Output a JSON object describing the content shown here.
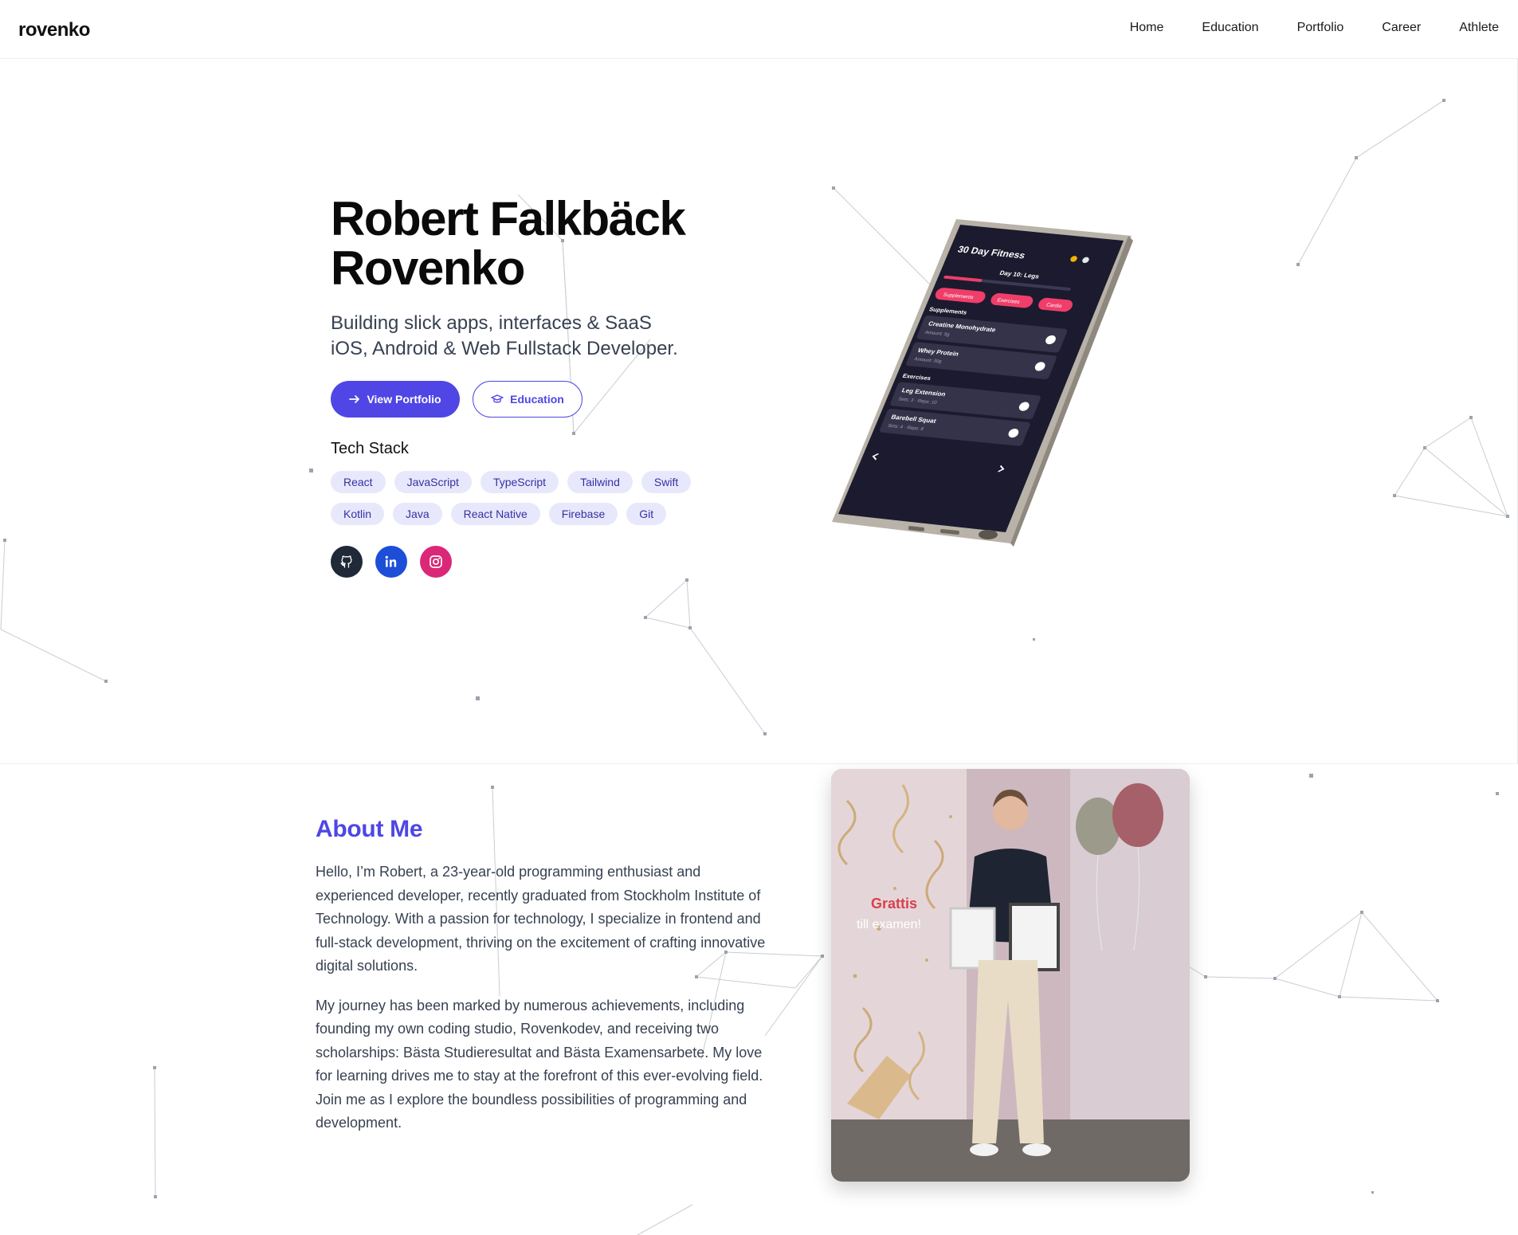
{
  "header": {
    "logo": "rovenko",
    "nav": [
      "Home",
      "Education",
      "Portfolio",
      "Career",
      "Athlete"
    ]
  },
  "hero": {
    "name_line1": "Robert Falkbäck",
    "name_line2": "Rovenko",
    "tagline_line1": "Building slick apps, interfaces & SaaS",
    "tagline_line2": "iOS, Android & Web Fullstack Developer.",
    "primary_button": "View Portfolio",
    "secondary_button": "Education",
    "stack_title": "Tech Stack",
    "stack": [
      "React",
      "JavaScript",
      "TypeScript",
      "Tailwind",
      "Swift",
      "Kotlin",
      "Java",
      "React Native",
      "Firebase",
      "Git"
    ],
    "socials": [
      "github-icon",
      "linkedin-icon",
      "instagram-icon"
    ]
  },
  "phone": {
    "app_title": "30 Day Fitness",
    "day": "Day 10: Legs",
    "tabs": [
      "Supplements",
      "Exercises",
      "Cardio"
    ],
    "section1": "Supplements",
    "items1": [
      {
        "name": "Creatine Monohydrate",
        "sub": "Amount: 5g"
      },
      {
        "name": "Whey Protein",
        "sub": "Amount: 30g"
      }
    ],
    "section2": "Exercises",
    "items2": [
      {
        "name": "Leg Extension",
        "sub": "Sets: 3 · Reps: 10"
      },
      {
        "name": "Barebell Squat",
        "sub": "Sets: 4 · Reps: 8"
      }
    ]
  },
  "about": {
    "title": "About Me",
    "p1": "Hello, I’m Robert, a 23-year-old programming enthusiast and experienced developer, recently graduated from Stockholm Institute of Technology. With a passion for technology, I specialize in frontend and full-stack development, thriving on the excitement of crafting innovative digital solutions.",
    "p2": "My journey has been marked by numerous achievements, including founding my own coding studio, Rovenkodev, and receiving two scholarships: Bästa Studieresultat and Bästa Examensarbete. My love for learning drives me to stay at the forefront of this ever-evolving field. Join me as I explore the boundless possibilities of programming and development."
  },
  "photo": {
    "banner_line1": "Grattis",
    "banner_line2": "till examen!"
  },
  "colors": {
    "accent": "#4f46e5",
    "chip_bg": "#e7e8fb",
    "github": "#1f2937",
    "linkedin": "#1d4ed8",
    "instagram": "#db2777"
  }
}
